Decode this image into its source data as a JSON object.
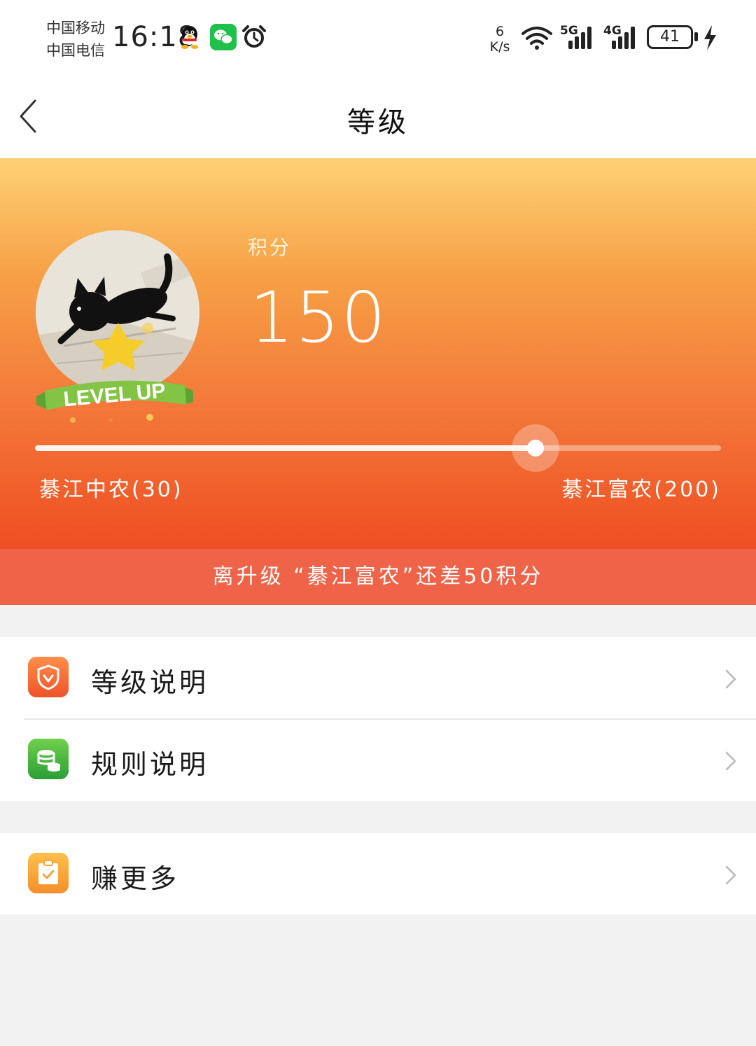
{
  "status_bar": {
    "carrier_1": "中国移动",
    "carrier_2": "中国电信",
    "time": "16:18",
    "net_speed_value": "6",
    "net_speed_unit": "K/s",
    "signal_1_tag": "5G",
    "signal_2_tag": "4G",
    "battery": "41",
    "icons": [
      "qq-icon",
      "wechat-icon",
      "alarm-icon",
      "wifi-icon",
      "signal-icon",
      "battery-icon",
      "charging-bolt-icon"
    ]
  },
  "nav": {
    "title": "等级",
    "back_icon": "chevron-left-icon"
  },
  "hero": {
    "score_label": "积分",
    "score_value": "150",
    "badge_text": "LEVEL UP",
    "current_level": "綦江中农(30)",
    "next_level": "綦江富农(200)",
    "progress_fraction": 0.73,
    "gradient_colors": [
      "#fdd174",
      "#f7a046",
      "#f37a3a",
      "#ef4e23"
    ]
  },
  "banner": {
    "text": "离升级 “綦江富农”还差50积分",
    "color": "#ef6449"
  },
  "menu": {
    "group_1": [
      {
        "label": "等级说明",
        "icon": "shield-icon"
      },
      {
        "label": "规则说明",
        "icon": "coins-icon"
      }
    ],
    "group_2": [
      {
        "label": "赚更多",
        "icon": "clipboard-check-icon"
      }
    ]
  }
}
